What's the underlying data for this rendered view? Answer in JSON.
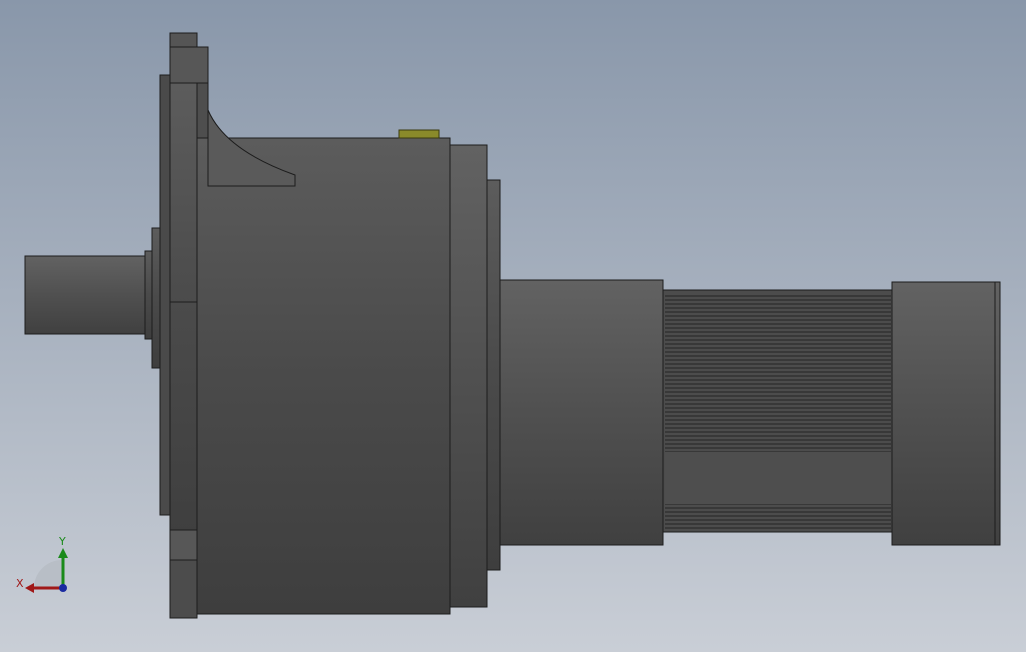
{
  "viewport": {
    "background_top": "#8997aa",
    "background_bottom": "#c9ced6"
  },
  "model": {
    "body_color": "#4f4f4f",
    "edge_color": "#1c1c1c",
    "accent_color": "#8a8a2a"
  },
  "triad": {
    "x_label": "X",
    "y_label": "Y",
    "x_color": "#a01818",
    "y_color": "#1a8a1a",
    "z_color": "#1a2aa0"
  }
}
